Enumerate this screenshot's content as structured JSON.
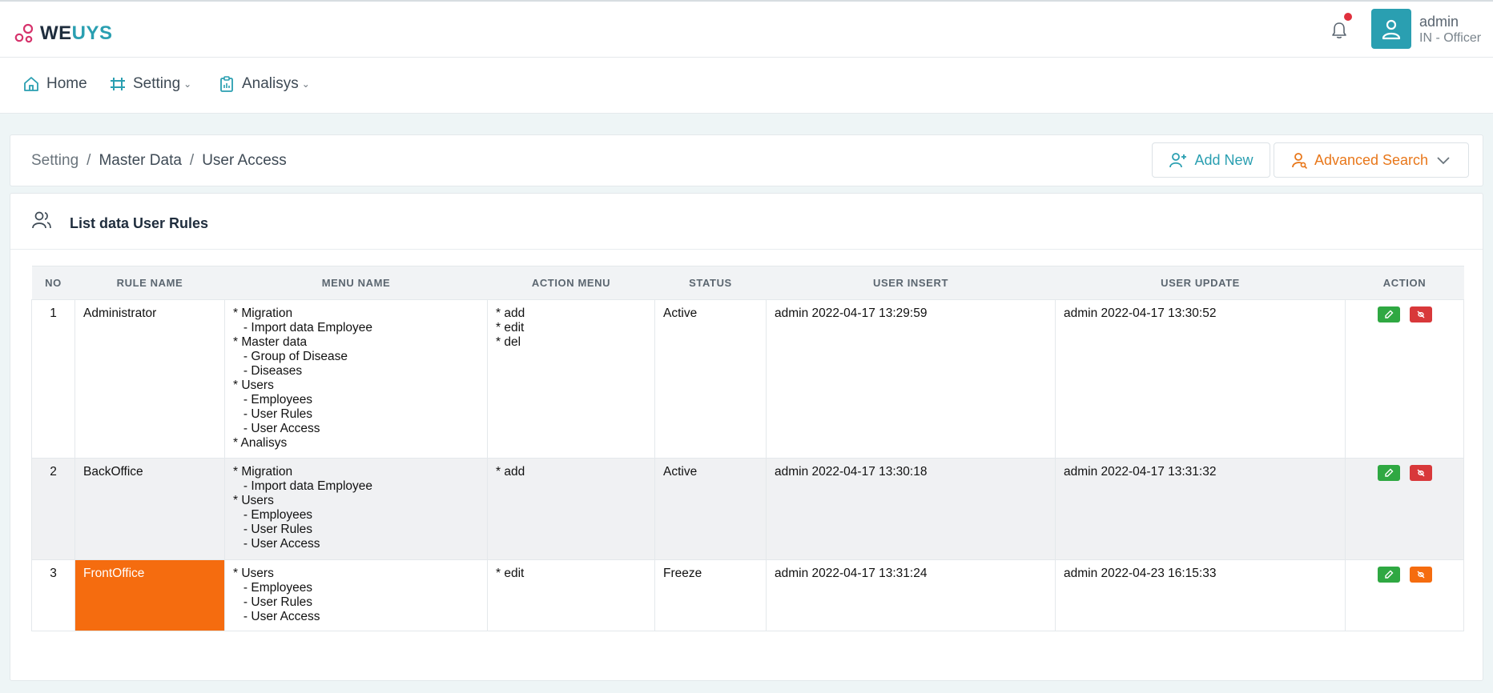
{
  "app": {
    "logo_we": "WE",
    "logo_uys": "UYS"
  },
  "header": {
    "user_name": "admin",
    "user_role": "IN - Officer",
    "notification_dot_color": "#e0303d"
  },
  "nav": [
    {
      "label": "Home",
      "icon": "home-icon"
    },
    {
      "label": "Setting",
      "icon": "setting-icon"
    },
    {
      "label": "Analisys",
      "icon": "clipboard-icon"
    }
  ],
  "breadcrumb": [
    "Setting",
    "Master Data",
    "User Access"
  ],
  "buttons": {
    "add_new": "Add New",
    "advanced_search": "Advanced Search"
  },
  "list": {
    "title": "List data User Rules"
  },
  "table": {
    "columns": [
      "NO",
      "RULE NAME",
      "MENU NAME",
      "ACTION MENU",
      "STATUS",
      "USER INSERT",
      "USER UPDATE",
      "ACTION"
    ],
    "rows": [
      {
        "no": "1",
        "rule": "Administrator",
        "menu": [
          "* Migration",
          "   - Import data Employee",
          "* Master data",
          "   - Group of Disease",
          "   - Diseases",
          "* Users",
          "   - Employees",
          "   - User Rules",
          "   - User Access",
          "* Analisys"
        ],
        "actions": [
          "* add",
          "* edit",
          "* del"
        ],
        "status": "Active",
        "insert": "admin  2022-04-17 13:29:59",
        "update": "admin  2022-04-17 13:30:52"
      },
      {
        "no": "2",
        "rule": "BackOffice",
        "menu": [
          "* Migration",
          "   - Import data Employee",
          "* Users",
          "   - Employees",
          "   - User Rules",
          "   - User Access"
        ],
        "actions": [
          "* add"
        ],
        "status": "Active",
        "insert": "admin  2022-04-17 13:30:18",
        "update": "admin  2022-04-17 13:31:32"
      },
      {
        "no": "3",
        "rule": "FrontOffice",
        "menu": [
          "* Users",
          "   - Employees",
          "   - User Rules",
          "   - User Access"
        ],
        "actions": [
          "* edit"
        ],
        "status": "Freeze",
        "insert": "admin  2022-04-17 13:31:24",
        "update": "admin  2022-04-23 16:15:33"
      }
    ]
  },
  "colors": {
    "accent": "#2a9fb1",
    "orange": "#f56c0f",
    "edit_green": "#2fa842",
    "delete_red": "#d8383a"
  }
}
